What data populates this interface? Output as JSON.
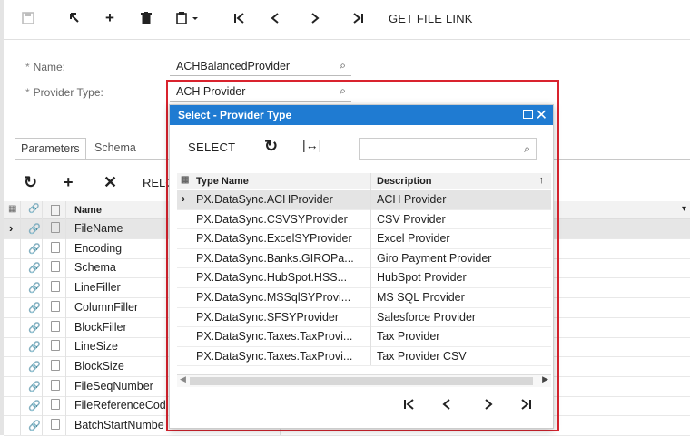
{
  "toolbar": {
    "icons": [
      "save-icon",
      "undo-icon",
      "add-icon",
      "delete-icon",
      "clipboard-icon",
      "first-icon",
      "prev-icon",
      "next-icon",
      "last-icon"
    ],
    "get_file_link": "GET FILE LINK"
  },
  "form": {
    "name_label": "Name:",
    "name_value": "ACHBalancedProvider",
    "provider_type_label": "Provider Type:",
    "provider_type_value": "ACH Provider",
    "required_mark": "*"
  },
  "tabs": [
    {
      "label": "Parameters",
      "active": true
    },
    {
      "label": "Schema",
      "active": false
    }
  ],
  "grid_toolbar": {
    "reload_label": "RELO"
  },
  "grid": {
    "header_name": "Name",
    "rows": [
      "FileName",
      "Encoding",
      "Schema",
      "LineFiller",
      "ColumnFiller",
      "BlockFiller",
      "LineSize",
      "BlockSize",
      "FileSeqNumber",
      "FileReferenceCod",
      "BatchStartNumbe"
    ],
    "selected_index": 0
  },
  "popup": {
    "title": "Select - Provider Type",
    "select_label": "SELECT",
    "search_placeholder": "",
    "col_type_name": "Type Name",
    "col_description": "Description",
    "sort_indicator": "↑",
    "rows": [
      {
        "type_name": "PX.DataSync.ACHProvider",
        "description": "ACH Provider"
      },
      {
        "type_name": "PX.DataSync.CSVSYProvider",
        "description": "CSV Provider"
      },
      {
        "type_name": "PX.DataSync.ExcelSYProvider",
        "description": "Excel Provider"
      },
      {
        "type_name": "PX.DataSync.Banks.GIROPa...",
        "description": "Giro Payment Provider"
      },
      {
        "type_name": "PX.DataSync.HubSpot.HSS...",
        "description": "HubSpot Provider"
      },
      {
        "type_name": "PX.DataSync.MSSqlSYProvi...",
        "description": "MS SQL Provider"
      },
      {
        "type_name": "PX.DataSync.SFSYProvider",
        "description": "Salesforce Provider"
      },
      {
        "type_name": "PX.DataSync.Taxes.TaxProvi...",
        "description": "Tax Provider"
      },
      {
        "type_name": "PX.DataSync.Taxes.TaxProvi...",
        "description": "Tax Provider CSV"
      }
    ],
    "selected_index": 0
  },
  "colors": {
    "popup_title_bg": "#1f7bd2",
    "highlight_frame": "#d9232e",
    "selected_row": "#e4e4e4"
  }
}
